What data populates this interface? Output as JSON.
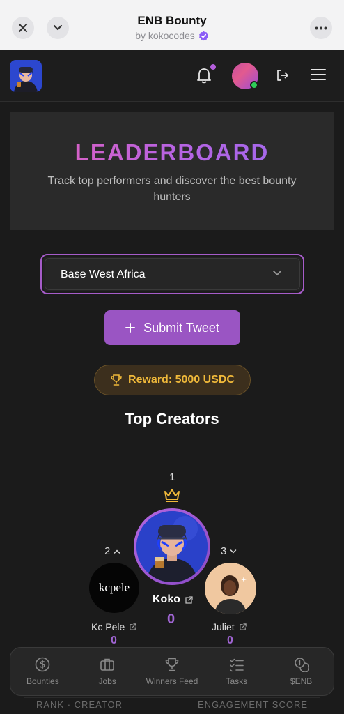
{
  "browser": {
    "title": "ENB Bounty",
    "subtitle": "by kokocodes"
  },
  "hero": {
    "title": "LEADERBOARD",
    "subtitle": "Track top performers and discover the best bounty hunters"
  },
  "filter": {
    "selected": "Base West Africa"
  },
  "submit_label": "Submit Tweet",
  "reward_label": "Reward: 5000 USDC",
  "section_title": "Top Creators",
  "podium": {
    "first": {
      "rank": "1",
      "name": "Koko",
      "score": "0"
    },
    "second": {
      "rank": "2",
      "name": "Kc Pele",
      "score": "0",
      "avatar_text": "kcpele"
    },
    "third": {
      "rank": "3",
      "name": "Juliet",
      "score": "0"
    }
  },
  "nav": [
    {
      "label": "Bounties",
      "icon": "dollar-circle-icon"
    },
    {
      "label": "Jobs",
      "icon": "briefcase-icon"
    },
    {
      "label": "Winners Feed",
      "icon": "trophy-icon"
    },
    {
      "label": "Tasks",
      "icon": "checklist-icon"
    },
    {
      "label": "$ENB",
      "icon": "coins-icon"
    }
  ],
  "table_headers": {
    "left": "RANK · CREATOR",
    "right": "ENGAGEMENT SCORE"
  },
  "colors": {
    "accent": "#9a55c3",
    "reward_gold": "#f0b93a",
    "background": "#1b1b1b"
  }
}
